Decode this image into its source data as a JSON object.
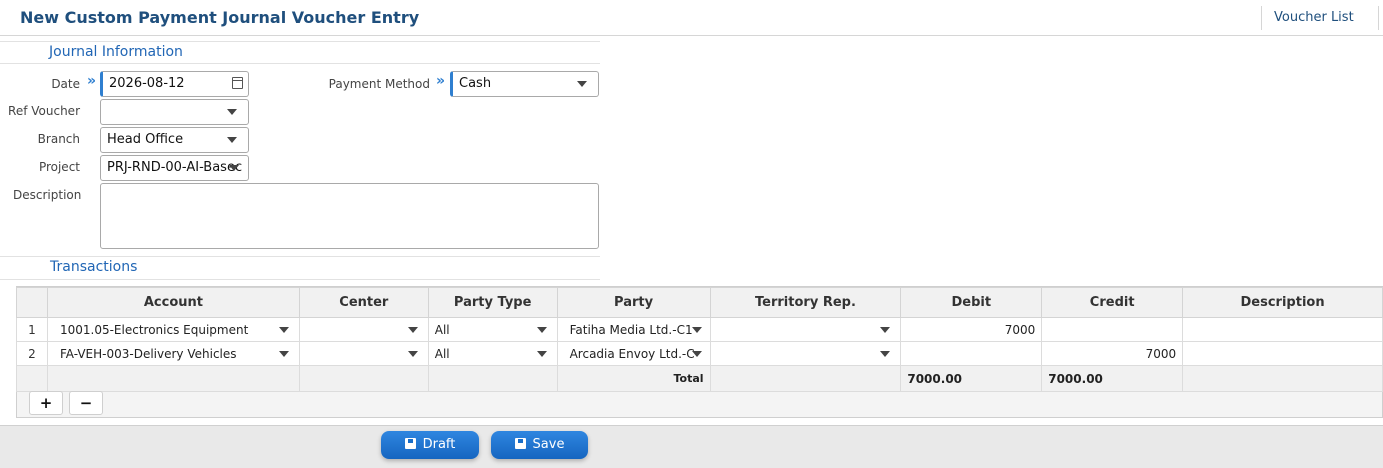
{
  "header": {
    "title": "New Custom Payment Journal Voucher Entry",
    "voucher_list_link": "Voucher List"
  },
  "journal": {
    "section_title": "Journal Information",
    "date_label": "Date",
    "date_value": "2026-08-12",
    "payment_method_label": "Payment Method",
    "payment_method_value": "Cash",
    "ref_voucher_label": "Ref Voucher",
    "ref_voucher_value": "",
    "branch_label": "Branch",
    "branch_value": "Head Office",
    "project_label": "Project",
    "project_value": "PRJ-RND-00-AI-Basec",
    "description_label": "Description",
    "description_value": ""
  },
  "transactions": {
    "section_title": "Transactions",
    "columns": [
      "Account",
      "Center",
      "Party Type",
      "Party",
      "Territory Rep.",
      "Debit",
      "Credit",
      "Description"
    ],
    "rows": [
      {
        "num": "1",
        "account": "1001.05-Electronics Equipment",
        "center": "",
        "party_type": "All",
        "party": "Fatiha Media Ltd.-C1",
        "territory_rep": "",
        "debit": "7000",
        "credit": "",
        "description": ""
      },
      {
        "num": "2",
        "account": "FA-VEH-003-Delivery Vehicles",
        "center": "",
        "party_type": "All",
        "party": "Arcadia Envoy Ltd.-C",
        "territory_rep": "",
        "debit": "",
        "credit": "7000",
        "description": ""
      }
    ],
    "total_label": "Total",
    "total_debit": "7000.00",
    "total_credit": "7000.00",
    "add_row_label": "+",
    "remove_row_label": "−"
  },
  "footer": {
    "draft_label": "Draft",
    "save_label": "Save"
  },
  "colors": {
    "title": "#1f4f7d",
    "section": "#2166b5",
    "button": "#1a6ec8",
    "required_marker": "#2f7fd0"
  },
  "icons": {
    "date_field": "calendar-icon",
    "required": "double-chevron-right-icon",
    "buttons": "floppy-disk-icon"
  }
}
